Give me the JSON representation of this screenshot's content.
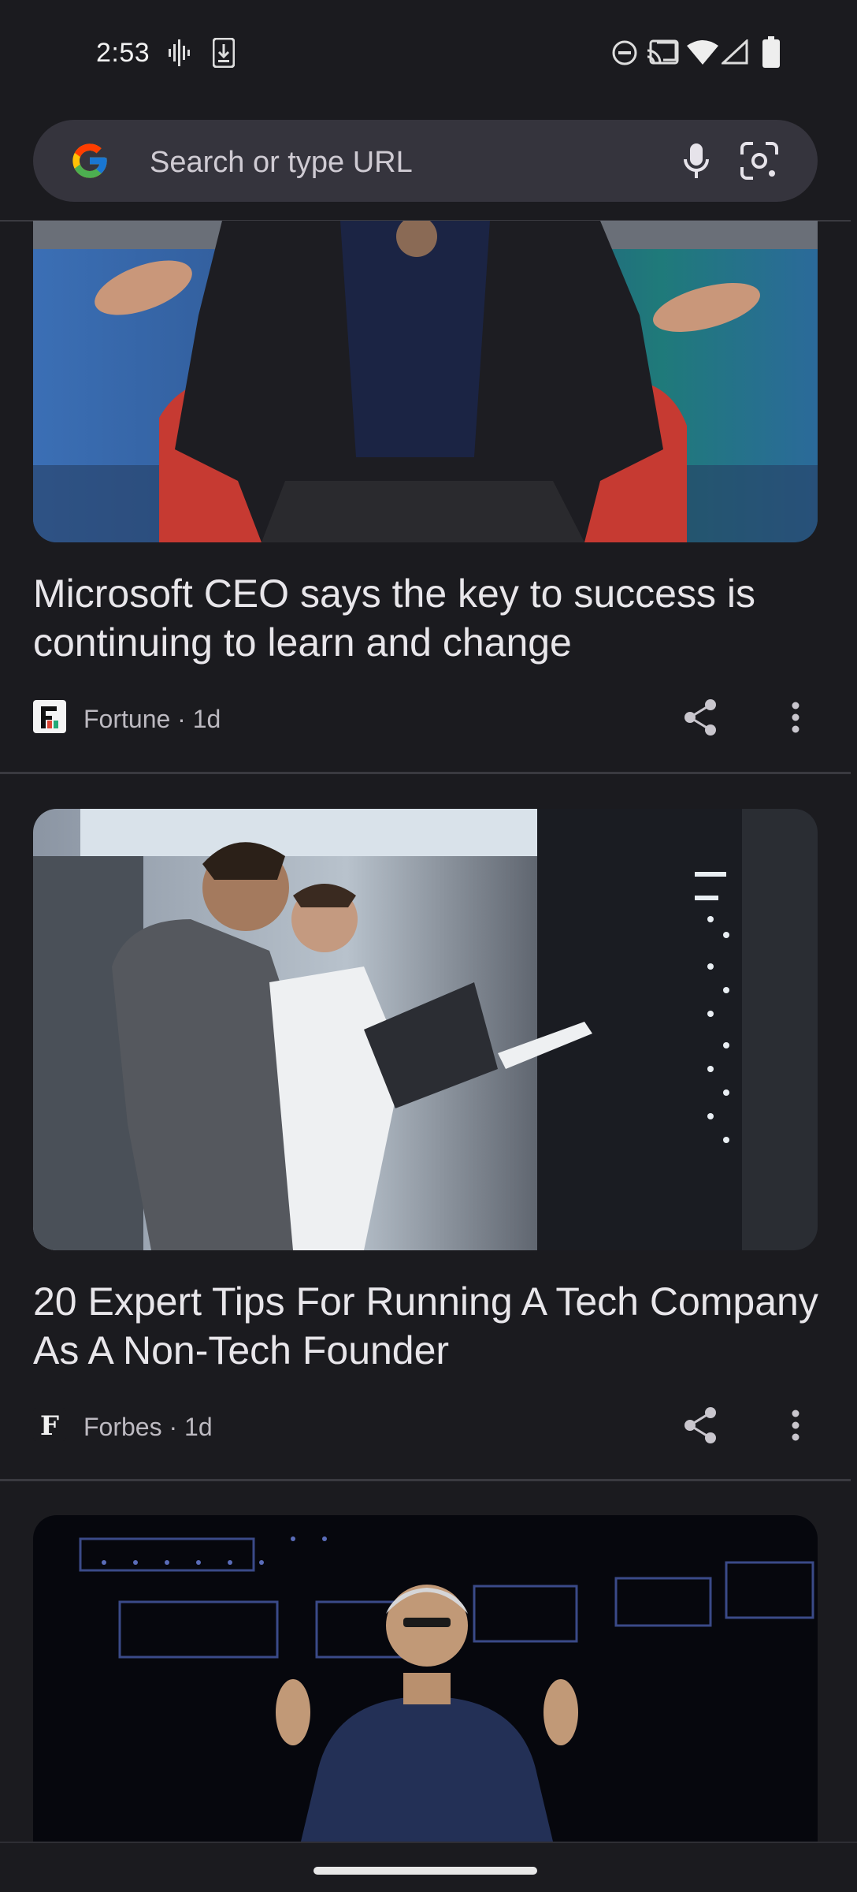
{
  "status_bar": {
    "time": "2:53",
    "left_icons": [
      "voicemail-icon",
      "download-icon"
    ],
    "right_icons": [
      "do-not-disturb-icon",
      "cast-icon",
      "wifi-icon",
      "signal-icon",
      "battery-icon"
    ]
  },
  "omnibox": {
    "placeholder": "Search or type URL",
    "icons": [
      "google-logo-icon",
      "microphone-icon",
      "lens-camera-icon"
    ]
  },
  "feed": {
    "cards": [
      {
        "title": "Microsoft CEO says the key to success is continuing to learn and change",
        "publisher": "Fortune",
        "age": "1d",
        "meta": "Fortune · 1d",
        "image_desc": "man-in-suit-red-chair"
      },
      {
        "title": "20 Expert Tips For Running A Tech Company As A Non-Tech Founder",
        "publisher": "Forbes",
        "age": "1d",
        "meta": "Forbes · 1d",
        "publisher_logo_letter": "F",
        "image_desc": "two-people-server-room-laptop"
      },
      {
        "image_desc": "man-leather-jacket-stage"
      }
    ]
  },
  "colors": {
    "background": "#1b1b1f",
    "omnibox": "#35343d",
    "title_text": "#e8e6ea",
    "meta_text": "#bdbac1"
  }
}
